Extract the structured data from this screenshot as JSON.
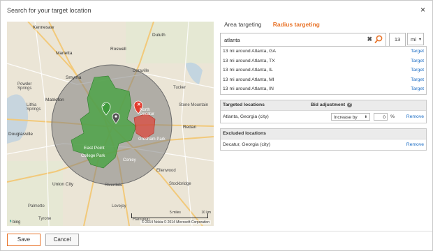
{
  "dialog": {
    "title": "Search for your target location",
    "close_symbol": "×"
  },
  "tabs": [
    {
      "label": "Area targeting",
      "active": false
    },
    {
      "label": "Radius targeting",
      "active": true
    }
  ],
  "search": {
    "value": "atlanta",
    "clear_symbol": "✖"
  },
  "radius": {
    "value": "13",
    "unit": "mi"
  },
  "results": [
    {
      "label": "13 mi around Atlanta, GA",
      "action": "Target"
    },
    {
      "label": "13 mi around Atlanta, TX",
      "action": "Target"
    },
    {
      "label": "13 mi around Atlanta, IL",
      "action": "Target"
    },
    {
      "label": "13 mi around Atlanta, MI",
      "action": "Target"
    },
    {
      "label": "13 mi around Atlanta, IN",
      "action": "Target"
    }
  ],
  "targeted": {
    "header": "Targeted locations",
    "bid_header": "Bid adjustment",
    "help_symbol": "?",
    "rows": [
      {
        "location": "Atlanta, Georgia (city)",
        "bid_mode": "Increase by",
        "bid_value": "0",
        "unit": "%",
        "action": "Remove"
      }
    ]
  },
  "excluded": {
    "header": "Excluded locations",
    "rows": [
      {
        "location": "Decatur, Georgia (city)",
        "action": "Remove"
      }
    ]
  },
  "map": {
    "labels": {
      "kennesaw": "Kennesaw",
      "duluth": "Duluth",
      "marietta": "Marietta",
      "roswell": "Roswell",
      "smyrna": "Smyrna",
      "doraville": "Doraville",
      "tucker": "Tucker",
      "powder_springs": "Powder\nSprings",
      "mableton": "Mableton",
      "stone_mountain": "Stone Mountain",
      "lithia_springs": "Lithia\nSprings",
      "north_decatur": "North\nDecatur",
      "redan": "Redan",
      "douglasville": "Douglasville",
      "gresham_park": "Gresham Park",
      "east_point": "East Point",
      "college_park": "College Park",
      "conley": "Conley",
      "union_city": "Union City",
      "palmetto": "Palmetto",
      "stockbridge": "Stockbridge",
      "riverdale": "Riverdale",
      "tyrone": "Tyrone",
      "hampton": "Hampton",
      "ellenwood": "Ellenwood",
      "lovejoy": "Lovejoy"
    },
    "scale_left": "5 miles",
    "scale_right": "10 km",
    "copyright": "© 2014 Nokia   © 2014 Microsoft Corporation",
    "logo": "bing",
    "target_pin": "✓",
    "excluded_pin": "✕"
  },
  "buttons": {
    "save": "Save",
    "cancel": "Cancel"
  },
  "colors": {
    "accent": "#e8742a",
    "link": "#1a6cc4",
    "target_area": "#3f9a3c",
    "excluded_area": "#e23b2e"
  }
}
